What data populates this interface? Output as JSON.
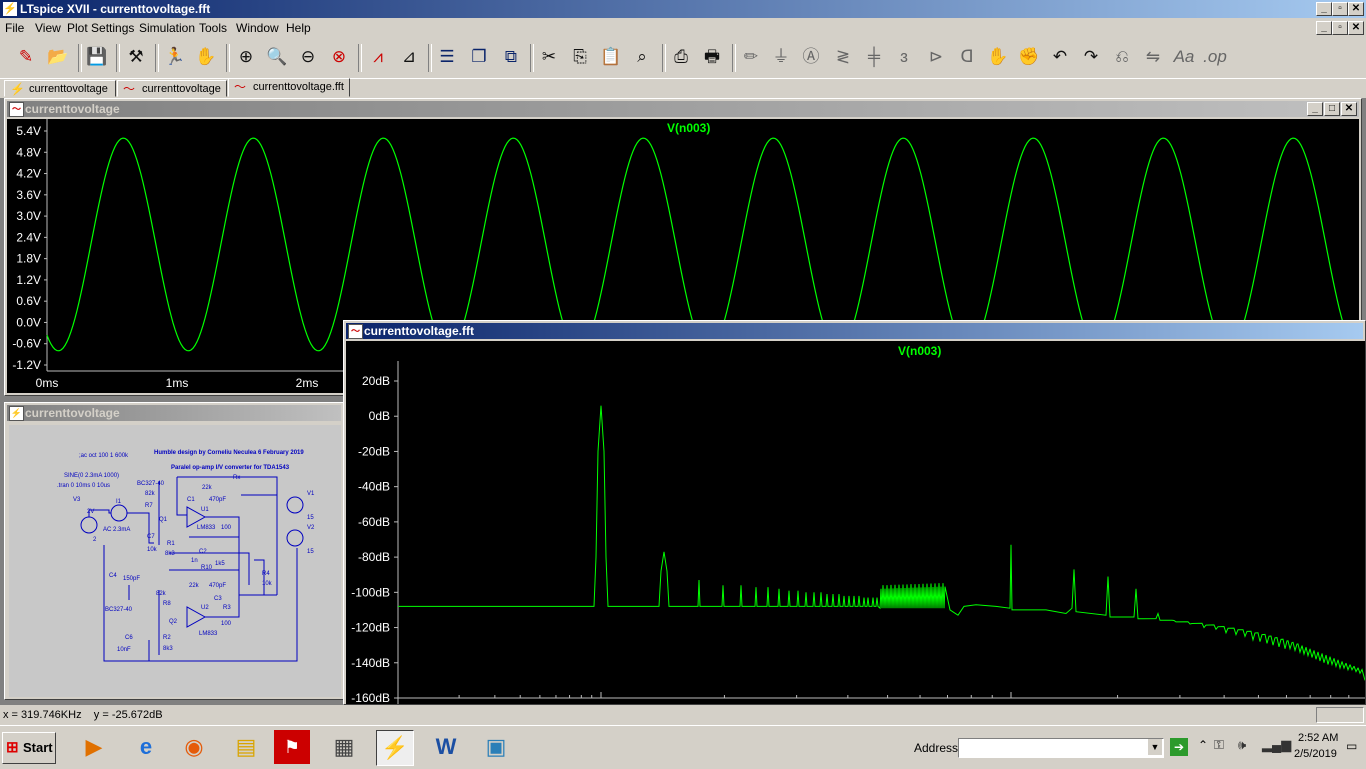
{
  "app": {
    "title": "LTspice XVII - currenttovoltage.fft"
  },
  "window_buttons": {
    "minimize": "_",
    "restore": "▫",
    "close": "✕"
  },
  "menu": [
    "File",
    "View",
    "Plot Settings",
    "Simulation",
    "Tools",
    "Window",
    "Help"
  ],
  "toolbar_icons": [
    "new-schematic",
    "open",
    "save",
    "control-panel",
    "run",
    "halt",
    "zoom-in",
    "zoom-area",
    "zoom-out",
    "zoom-full",
    "autorange",
    "measure",
    "tile-horizontal",
    "cascade",
    "tile",
    "cut",
    "copy",
    "paste",
    "find",
    "print-preview",
    "print",
    "wire",
    "ground",
    "label",
    "resistor",
    "capacitor",
    "inductor",
    "diode",
    "component",
    "move",
    "drag",
    "undo",
    "redo",
    "rotate",
    "mirror",
    "text",
    "spice-directive"
  ],
  "tabs": [
    {
      "label": "currenttovoltage",
      "icon": "schematic-icon"
    },
    {
      "label": "currenttovoltage",
      "icon": "waveform-icon"
    },
    {
      "label": "currenttovoltage.fft",
      "icon": "fft-icon"
    }
  ],
  "waveform_window": {
    "title": "currenttovoltage",
    "trace": "V(n003)",
    "trace_color": "#00ff00",
    "y_ticks": [
      "5.4V",
      "4.8V",
      "4.2V",
      "3.6V",
      "3.0V",
      "2.4V",
      "1.8V",
      "1.2V",
      "0.6V",
      "0.0V",
      "-0.6V",
      "-1.2V"
    ],
    "x_ticks": [
      "0ms",
      "1ms",
      "2ms"
    ]
  },
  "schematic_window": {
    "title": "currenttovoltage",
    "labels": {
      "directive1": ";ac oct 100 1 600k",
      "credit": "Humble design by Corneliu Neculea 6 February 2019",
      "subtitle": "Paralel op-amp I/V converter  for TDA1543",
      "sine": "SINE(0 2.3mA 1000)",
      "tran": ".tran 0 10ms 0 10us",
      "v3": "V3",
      "v3val": "2V",
      "v3n": "2",
      "i1": "I1",
      "ac": "AC 2.3mA",
      "bc1": "BC327-40",
      "r7": "R7",
      "r7v": "82k",
      "q1": "Q1",
      "c7": "C7",
      "r1": "R1",
      "r1v": "8k3",
      "r1b": "10k",
      "c4": "C4",
      "c4v": "150pF",
      "c2": "C2",
      "c2v": "1n",
      "r10": "R10",
      "r10v": "1k5",
      "r4": "R4",
      "r4v": "10k",
      "u1": "U1",
      "lm1": "LM833",
      "r5v": "22k",
      "c1": "C1",
      "c1v": "470pF",
      "r6v": "100",
      "v1": "V1",
      "v1v": "15",
      "v2": "V2",
      "v2v": "15",
      "bc2": "BC327-40",
      "r8": "R8",
      "r8v": "82k",
      "q2": "Q2",
      "c3": "C3",
      "c3v": "470pF",
      "r9v": "22k",
      "u2": "U2",
      "lm2": "LM833",
      "r3": "R3",
      "r3v": "100",
      "c6": "C6",
      "c6v": "10nF",
      "r2": "R2",
      "r2v": "8k3",
      "rx": "Rx"
    }
  },
  "fft_window": {
    "title": "currenttovoltage.fft",
    "trace": "V(n003)",
    "y_ticks": [
      "20dB",
      "0dB",
      "-20dB",
      "-40dB",
      "-60dB",
      "-80dB",
      "-100dB",
      "-120dB",
      "-140dB",
      "-160dB"
    ]
  },
  "chart_data": [
    {
      "type": "line",
      "title": "V(n003)",
      "xlabel": "",
      "ylabel": "",
      "x_ticks": [
        "0ms",
        "1ms",
        "2ms"
      ],
      "ylim": [
        -1.2,
        5.4
      ],
      "series": [
        {
          "name": "V(n003)",
          "amplitude": 3.0,
          "offset": 2.2,
          "frequency_hz": 1000,
          "color": "#00ff00"
        }
      ],
      "grid": false
    },
    {
      "type": "line",
      "title": "V(n003)",
      "xlabel": "",
      "ylabel": "",
      "ylim": [
        -160,
        20
      ],
      "x_scale": "log",
      "series": [
        {
          "name": "V(n003)",
          "fundamental_db": 6,
          "second_harmonic_db": -77,
          "noise_floor_db": -108,
          "color": "#00ff00"
        }
      ],
      "grid": false
    }
  ],
  "status": {
    "coords": "x = 319.746KHz    y = -25.672dB"
  },
  "taskbar": {
    "start": "Start",
    "address_label": "Address",
    "clock_time": "2:52 AM",
    "clock_date": "2/5/2019",
    "apps": [
      "media-player",
      "internet-explorer",
      "firefox",
      "file-explorer",
      "acrobat",
      "calculator",
      "ltspice",
      "word",
      "photo-viewer"
    ]
  }
}
